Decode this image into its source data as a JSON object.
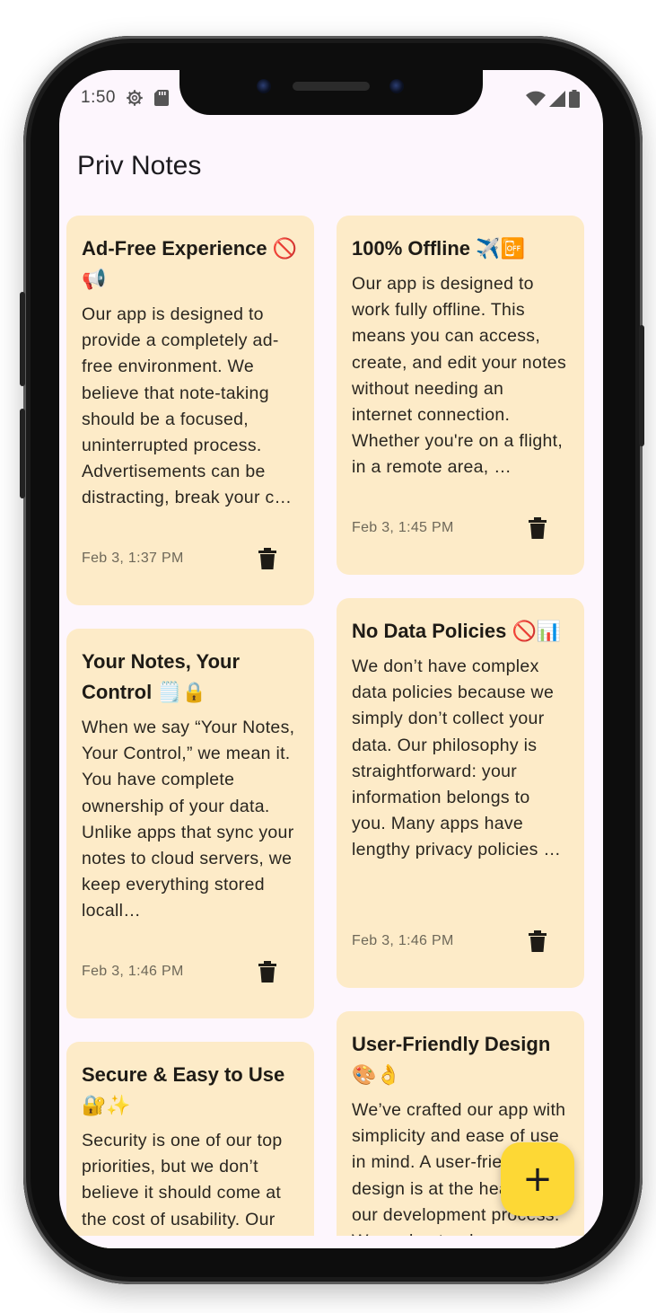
{
  "status_bar": {
    "time": "1:50"
  },
  "app": {
    "title": "Priv Notes"
  },
  "notes_left": [
    {
      "title": "Ad-Free Experience 🚫📢",
      "body": "Our app is designed to provide a completely ad-free environment. We believe that note-taking should be a focused, uninterrupted process. Advertisements can be distracting, break your c…",
      "date": "Feb 3, 1:37 PM"
    },
    {
      "title": "Your Notes, Your Control 🗒️🔒",
      "body": "When we say “Your Notes, Your Control,” we mean it. You have complete ownership of your data. Unlike apps that sync your notes to cloud servers, we keep everything stored locall…",
      "date": "Feb 3, 1:46 PM"
    },
    {
      "title": "Secure & Easy to Use 🔐✨",
      "body": "Security is one of our top priorities, but we don’t believe it should come at the cost of usability. Our",
      "date": ""
    }
  ],
  "notes_right": [
    {
      "title": "100% Offline ✈️📴",
      "body": "Our app is designed to work fully offline. This means you can access, create, and edit your notes without needing an internet connection. Whether you're on a flight, in a remote area, …",
      "date": "Feb 3, 1:45 PM"
    },
    {
      "title": "No Data Policies 🚫📊",
      "body": "We don’t have complex data policies because we simply don’t collect your data. Our philosophy is straightforward: your information belongs to you. Many apps have lengthy privacy policies …",
      "date": "Feb 3, 1:46 PM"
    },
    {
      "title": "User-Friendly Design 🎨👌",
      "body": "We’ve crafted our app with simplicity and ease of use in mind. A user-friendly design is at the heart of our development process. We understand",
      "date": ""
    }
  ],
  "fab": {
    "label": "+"
  },
  "colors": {
    "card_bg": "#fdebc8",
    "screen_bg": "#fdf6fd",
    "fab_bg": "#fdd835"
  },
  "icons": [
    "settings-gear-icon",
    "sd-card-icon",
    "wifi-icon",
    "signal-icon",
    "battery-icon",
    "trash-icon",
    "plus-icon"
  ]
}
